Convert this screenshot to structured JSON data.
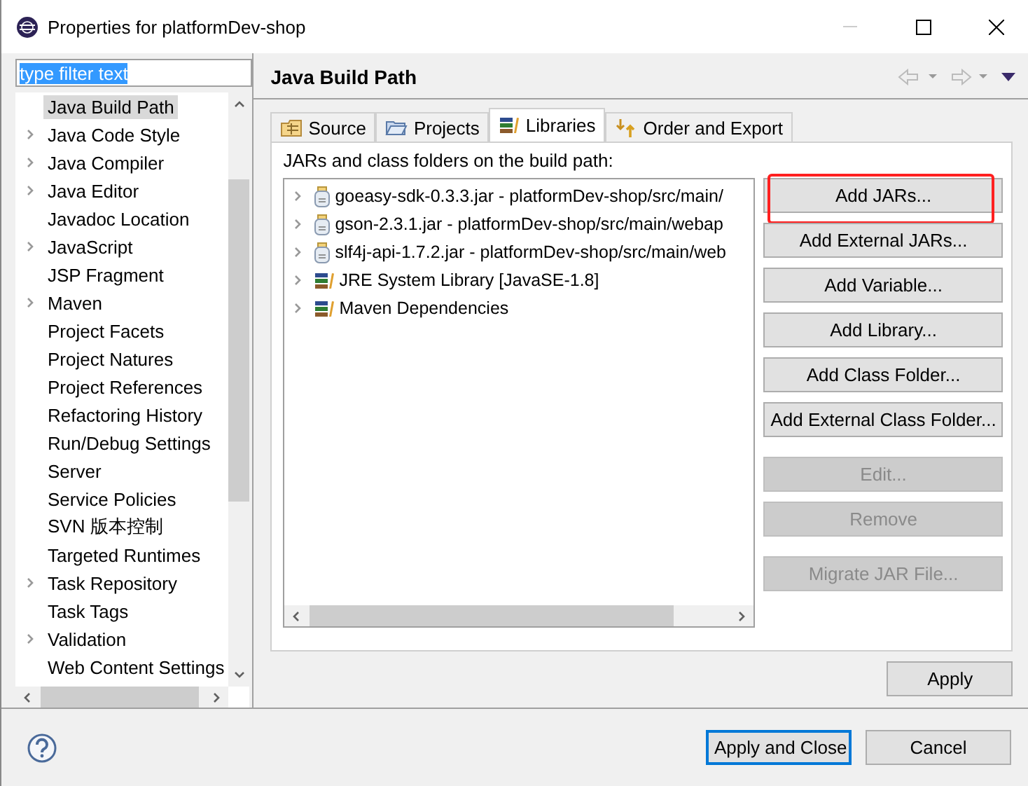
{
  "window": {
    "title": "Properties for platformDev-shop"
  },
  "filter": {
    "value": "type filter text",
    "selected_text": true
  },
  "tree": [
    {
      "label": "Java Build Path",
      "expandable": false,
      "selected": true
    },
    {
      "label": "Java Code Style",
      "expandable": true,
      "selected": false
    },
    {
      "label": "Java Compiler",
      "expandable": true,
      "selected": false
    },
    {
      "label": "Java Editor",
      "expandable": true,
      "selected": false
    },
    {
      "label": "Javadoc Location",
      "expandable": false,
      "selected": false
    },
    {
      "label": "JavaScript",
      "expandable": true,
      "selected": false
    },
    {
      "label": "JSP Fragment",
      "expandable": false,
      "selected": false
    },
    {
      "label": "Maven",
      "expandable": true,
      "selected": false
    },
    {
      "label": "Project Facets",
      "expandable": false,
      "selected": false
    },
    {
      "label": "Project Natures",
      "expandable": false,
      "selected": false
    },
    {
      "label": "Project References",
      "expandable": false,
      "selected": false
    },
    {
      "label": "Refactoring History",
      "expandable": false,
      "selected": false
    },
    {
      "label": "Run/Debug Settings",
      "expandable": false,
      "selected": false
    },
    {
      "label": "Server",
      "expandable": false,
      "selected": false
    },
    {
      "label": "Service Policies",
      "expandable": false,
      "selected": false
    },
    {
      "label": "SVN 版本控制",
      "expandable": false,
      "selected": false
    },
    {
      "label": "Targeted Runtimes",
      "expandable": false,
      "selected": false
    },
    {
      "label": "Task Repository",
      "expandable": true,
      "selected": false
    },
    {
      "label": "Task Tags",
      "expandable": false,
      "selected": false
    },
    {
      "label": "Validation",
      "expandable": true,
      "selected": false
    },
    {
      "label": "Web Content Settings",
      "expandable": false,
      "selected": false
    }
  ],
  "page": {
    "title": "Java Build Path"
  },
  "tabs": [
    {
      "label": "Source",
      "kind": "source",
      "selected": false
    },
    {
      "label": "Projects",
      "kind": "projects",
      "selected": false
    },
    {
      "label": "Libraries",
      "kind": "libraries",
      "selected": true
    },
    {
      "label": "Order and Export",
      "kind": "order",
      "selected": false
    }
  ],
  "libraries": {
    "caption": "JARs and class folders on the build path:",
    "entries": [
      {
        "label": "goeasy-sdk-0.3.3.jar - platformDev-shop/src/main/",
        "kind": "jar"
      },
      {
        "label": "gson-2.3.1.jar - platformDev-shop/src/main/webap",
        "kind": "jar"
      },
      {
        "label": "slf4j-api-1.7.2.jar - platformDev-shop/src/main/web",
        "kind": "jar"
      },
      {
        "label": "JRE System Library [JavaSE-1.8]",
        "kind": "library"
      },
      {
        "label": "Maven Dependencies",
        "kind": "library"
      }
    ],
    "button_groups": [
      [
        {
          "label": "Add JARs...",
          "disabled": false,
          "highlighted": true
        },
        {
          "label": "Add External JARs...",
          "disabled": false,
          "highlighted": false
        },
        {
          "label": "Add Variable...",
          "disabled": false,
          "highlighted": false
        },
        {
          "label": "Add Library...",
          "disabled": false,
          "highlighted": false
        },
        {
          "label": "Add Class Folder...",
          "disabled": false,
          "highlighted": false
        },
        {
          "label": "Add External Class Folder...",
          "disabled": false,
          "highlighted": false
        }
      ],
      [
        {
          "label": "Edit...",
          "disabled": true,
          "highlighted": false
        },
        {
          "label": "Remove",
          "disabled": true,
          "highlighted": false
        }
      ],
      [
        {
          "label": "Migrate JAR File...",
          "disabled": true,
          "highlighted": false
        }
      ]
    ]
  },
  "apply_button": "Apply",
  "footer": {
    "buttons": [
      {
        "label": "Apply and Close",
        "default": true
      },
      {
        "label": "Cancel",
        "default": false
      }
    ]
  }
}
